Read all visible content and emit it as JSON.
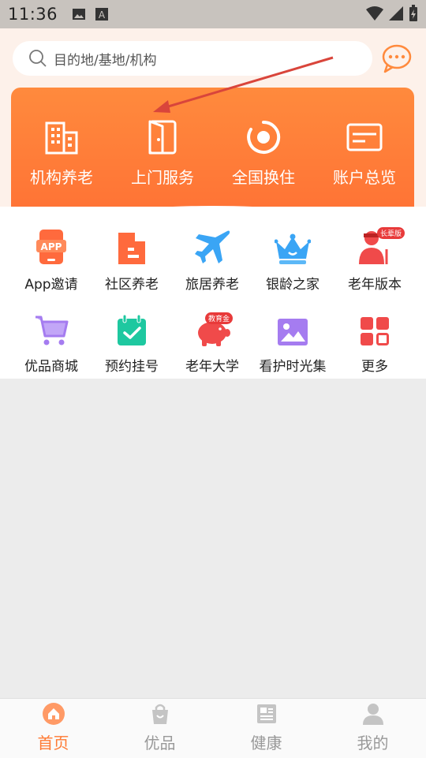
{
  "status_bar": {
    "time": "11:36"
  },
  "search": {
    "placeholder": "目的地/基地/机构"
  },
  "top_services": [
    {
      "label": "机构养老",
      "icon": "building-icon"
    },
    {
      "label": "上门服务",
      "icon": "door-icon"
    },
    {
      "label": "全国换住",
      "icon": "target-icon"
    },
    {
      "label": "账户总览",
      "icon": "card-icon"
    }
  ],
  "grid_items": [
    {
      "label": "App邀请",
      "icon": "phone-app-icon",
      "color": "#ff6a3d"
    },
    {
      "label": "社区养老",
      "icon": "community-building-icon",
      "color": "#ff6a3d"
    },
    {
      "label": "旅居养老",
      "icon": "airplane-icon",
      "color": "#3aa5f5"
    },
    {
      "label": "银龄之家",
      "icon": "crown-icon",
      "color": "#3aa5f5"
    },
    {
      "label": "老年版本",
      "icon": "elder-person-icon",
      "color": "#f04a4a",
      "badge": "长辈版"
    },
    {
      "label": "优品商城",
      "icon": "cart-icon",
      "color": "#a57cf0"
    },
    {
      "label": "预约挂号",
      "icon": "calendar-check-icon",
      "color": "#1ec8a0"
    },
    {
      "label": "老年大学",
      "icon": "piggy-bank-icon",
      "color": "#f04a4a",
      "badge": "教育金"
    },
    {
      "label": "看护时光集",
      "icon": "image-icon",
      "color": "#a57cf0"
    },
    {
      "label": "更多",
      "icon": "grid-more-icon",
      "color": "#f04a4a"
    }
  ],
  "bottom_nav": [
    {
      "label": "首页",
      "icon": "home-icon",
      "active": true
    },
    {
      "label": "优品",
      "icon": "shopping-bag-icon",
      "active": false
    },
    {
      "label": "健康",
      "icon": "health-news-icon",
      "active": false
    },
    {
      "label": "我的",
      "icon": "person-icon",
      "active": false
    }
  ],
  "colors": {
    "accent": "#ff7a33",
    "orange_card": "#ff7f38",
    "annotation_arrow": "#d9453b"
  }
}
